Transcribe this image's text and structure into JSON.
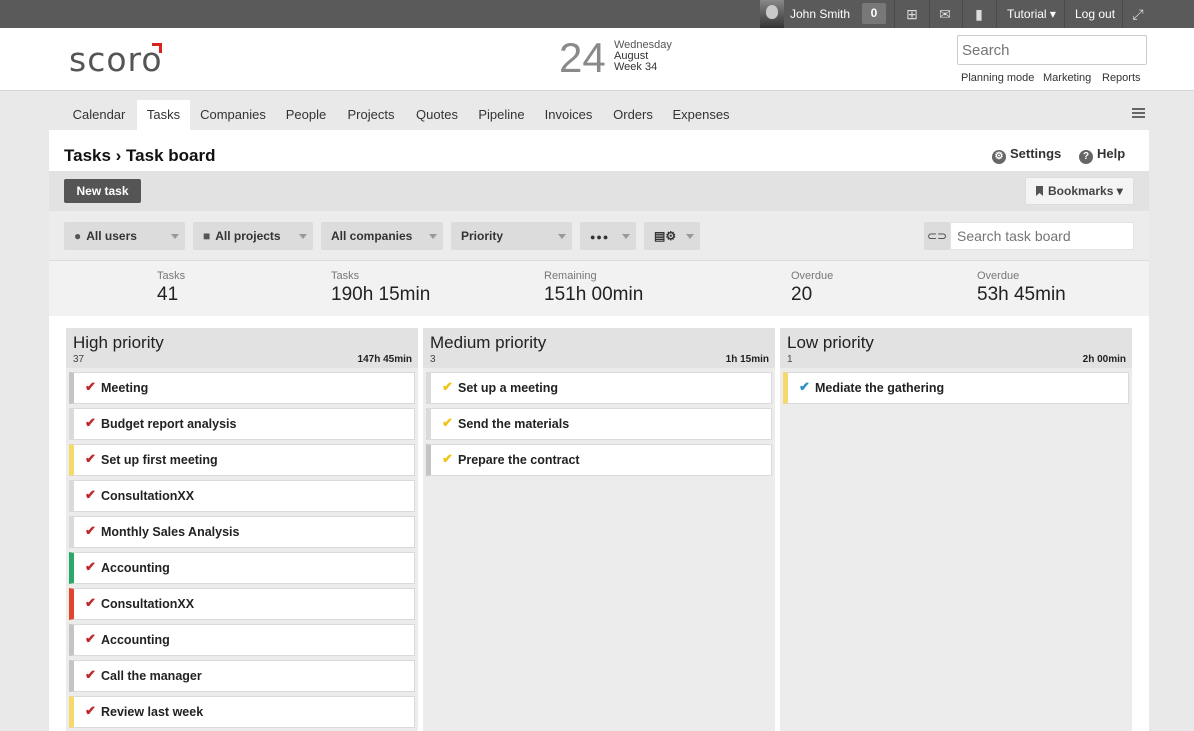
{
  "topbar": {
    "user_name": "John Smith",
    "notification_count": "0",
    "tutorial_label": "Tutorial ▾",
    "logout_label": "Log out"
  },
  "header": {
    "logo": "scoro",
    "day": "24",
    "weekday": "Wednesday",
    "month": "August",
    "week": "Week 34",
    "search_placeholder": "Search",
    "links": [
      "Planning mode",
      "Marketing",
      "Reports"
    ]
  },
  "nav": {
    "tabs": [
      "Calendar",
      "Tasks",
      "Companies",
      "People",
      "Projects",
      "Quotes",
      "Pipeline",
      "Invoices",
      "Orders",
      "Expenses"
    ],
    "active": "Tasks"
  },
  "page": {
    "breadcrumb": "Tasks › Task board",
    "settings_label": "Settings",
    "help_label": "Help",
    "new_task_label": "New task",
    "bookmarks_label": "Bookmarks ▾"
  },
  "filters": {
    "users": "All users",
    "projects": "All projects",
    "companies": "All companies",
    "priority": "Priority",
    "more": "●●●",
    "search_placeholder": "Search task board"
  },
  "stats": [
    {
      "label": "Tasks",
      "value": "41"
    },
    {
      "label": "Tasks",
      "value": "190h 15min"
    },
    {
      "label": "Remaining",
      "value": "151h 00min"
    },
    {
      "label": "Overdue",
      "value": "20"
    },
    {
      "label": "Overdue",
      "value": "53h 45min"
    }
  ],
  "columns": [
    {
      "title": "High priority",
      "count": "37",
      "total": "147h 45min",
      "check_color": "#c0272d",
      "cards": [
        {
          "label": "Meeting",
          "color": "#c4c4c4"
        },
        {
          "label": "Budget report analysis",
          "color": "#ffffff"
        },
        {
          "label": "Set up first meeting",
          "color": "#f6d96b"
        },
        {
          "label": "ConsultationXX",
          "color": "#ffffff"
        },
        {
          "label": "Monthly Sales Analysis",
          "color": "#ffffff"
        },
        {
          "label": "Accounting",
          "color": "#2aa86a"
        },
        {
          "label": "ConsultationXX",
          "color": "#e0452e"
        },
        {
          "label": "Accounting",
          "color": "#c4c4c4"
        },
        {
          "label": "Call the manager",
          "color": "#c4c4c4"
        },
        {
          "label": "Review last week",
          "color": "#f6d96b"
        }
      ]
    },
    {
      "title": "Medium priority",
      "count": "3",
      "total": "1h 15min",
      "check_color": "#f0c419",
      "cards": [
        {
          "label": "Set up a meeting",
          "color": "#ffffff"
        },
        {
          "label": "Send the materials",
          "color": "#ffffff"
        },
        {
          "label": "Prepare the contract",
          "color": "#c4c4c4"
        }
      ]
    },
    {
      "title": "Low priority",
      "count": "1",
      "total": "2h 00min",
      "check_color": "#2b8fc9",
      "cards": [
        {
          "label": "Mediate the gathering",
          "color": "#f6d96b"
        }
      ]
    }
  ]
}
